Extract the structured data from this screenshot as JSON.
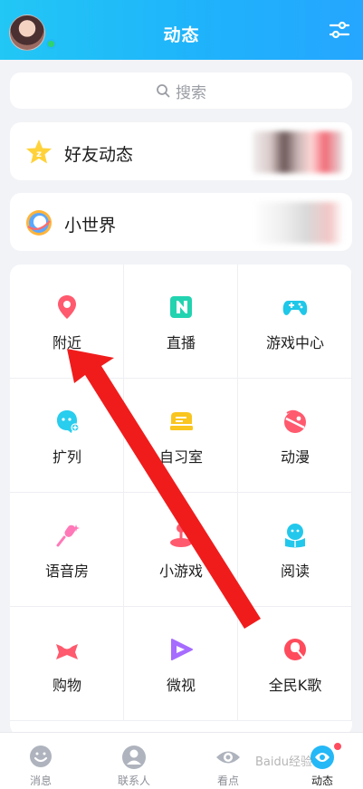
{
  "header": {
    "title": "动态",
    "avatar_icon": "avatar-image",
    "settings_icon": "filter-sliders-icon"
  },
  "search": {
    "placeholder": "搜索"
  },
  "cards": [
    {
      "label": "好友动态",
      "icon": "star-icon"
    },
    {
      "label": "小世界",
      "icon": "small-world-icon"
    }
  ],
  "grid": [
    {
      "label": "附近",
      "icon": "location-pin-icon",
      "color": "#ff5a6e"
    },
    {
      "label": "直播",
      "icon": "live-play-icon",
      "color": "#22d3b0"
    },
    {
      "label": "游戏中心",
      "icon": "gamepad-icon",
      "color": "#1fc7e8"
    },
    {
      "label": "扩列",
      "icon": "friends-add-icon",
      "color": "#29cdee"
    },
    {
      "label": "自习室",
      "icon": "study-room-icon",
      "color": "#f9c51e"
    },
    {
      "label": "动漫",
      "icon": "anime-icon",
      "color": "#ff5a6e"
    },
    {
      "label": "语音房",
      "icon": "microphone-icon",
      "color": "#ff79b8"
    },
    {
      "label": "小游戏",
      "icon": "joystick-icon",
      "color": "#ff5a6e"
    },
    {
      "label": "阅读",
      "icon": "reading-icon",
      "color": "#22c8ec"
    },
    {
      "label": "购物",
      "icon": "shopping-icon",
      "color": "#ff5a6e"
    },
    {
      "label": "微视",
      "icon": "weishi-icon",
      "color": "#a66bff"
    },
    {
      "label": "全民K歌",
      "icon": "karaoke-icon",
      "color": "#ff4b5c"
    }
  ],
  "tabbar": [
    {
      "label": "消息",
      "icon": "message-icon"
    },
    {
      "label": "联系人",
      "icon": "contacts-icon"
    },
    {
      "label": "看点",
      "icon": "eye-icon"
    },
    {
      "label": "动态",
      "icon": "moments-icon",
      "active": true
    }
  ],
  "watermark": "Baidu经验",
  "colors": {
    "header_start": "#22c7f5",
    "header_end": "#25a6ff",
    "arrow": "#f01c1c"
  }
}
